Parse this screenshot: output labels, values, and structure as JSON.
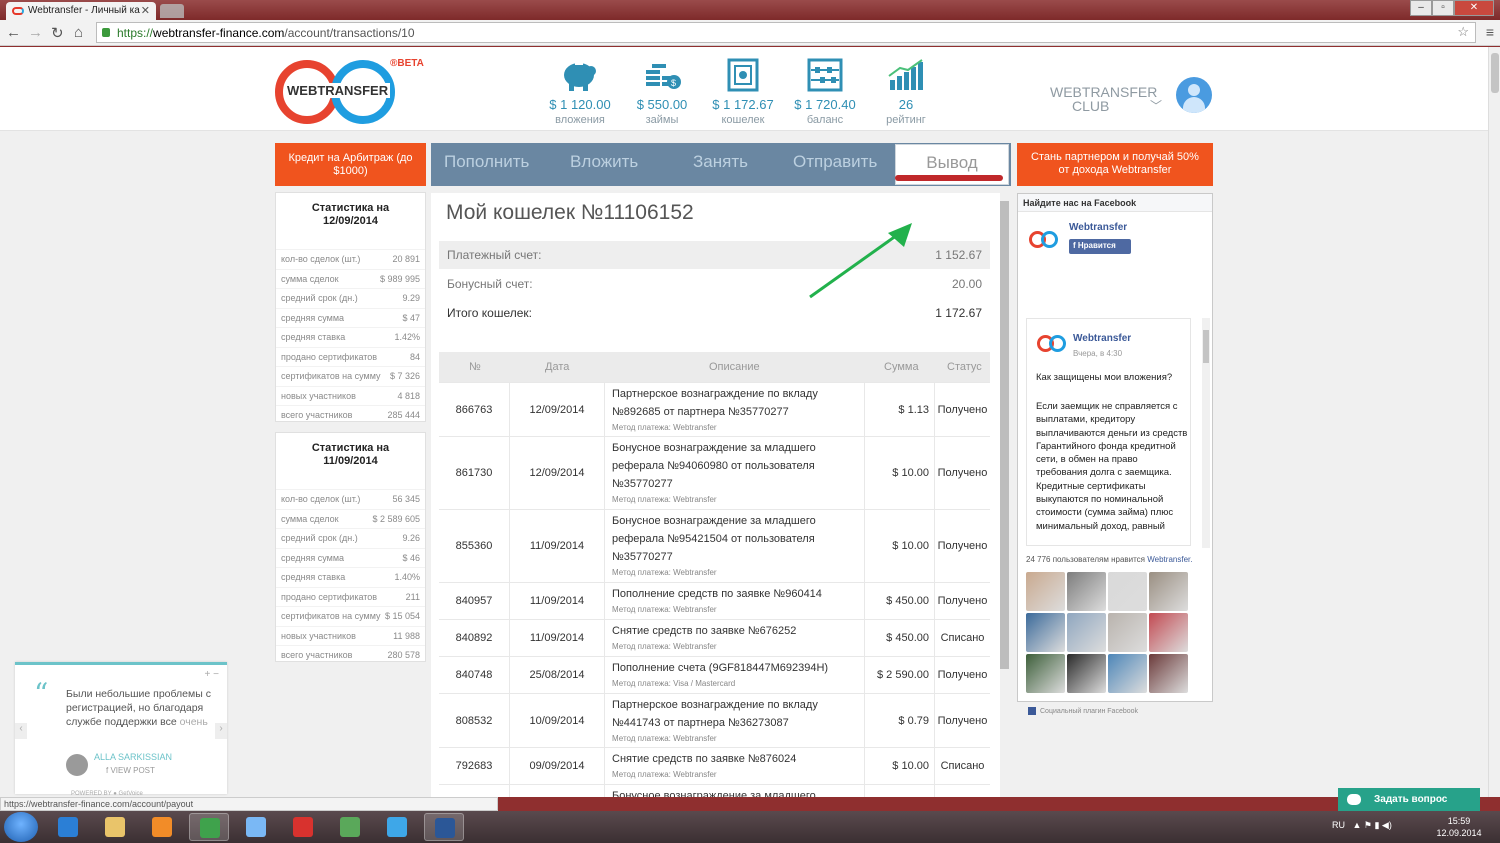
{
  "browser": {
    "tab_title": "Webtransfer - Личный ка",
    "url_scheme": "https://",
    "url_domain": "webtransfer-finance.com",
    "url_path": "/account/transactions/10",
    "status_url": "https://webtransfer-finance.com/account/payout"
  },
  "header": {
    "logo_text": "WEBTRANSFER",
    "beta": "®BETA",
    "stats": [
      {
        "icon": "piggy-bank-icon",
        "value": "$ 1 120.00",
        "label": "вложения"
      },
      {
        "icon": "coins-icon",
        "value": "$ 550.00",
        "label": "займы"
      },
      {
        "icon": "safe-icon",
        "value": "$ 1 172.67",
        "label": "кошелек"
      },
      {
        "icon": "abacus-icon",
        "value": "$ 1 720.40",
        "label": "баланс"
      },
      {
        "icon": "rating-chart-icon",
        "value": "26",
        "label": "рейтинг"
      }
    ],
    "club_line1": "WEBTRANSFER",
    "club_line2": "CLUB"
  },
  "left_promo": "Кредит на Арбитраж (до $1000)",
  "right_promo": "Стань партнером и получай 50% от дохода Webtransfer",
  "tabs": [
    "Пополнить",
    "Вложить",
    "Занять",
    "Отправить",
    "Вывод"
  ],
  "stat_boxes": [
    {
      "title_line1": "Статистика на",
      "title_line2": "12/09/2014",
      "rows": [
        {
          "label": "кол-во сделок (шт.)",
          "value": "20 891"
        },
        {
          "label": "сумма сделок",
          "value": "$ 989 995"
        },
        {
          "label": "средний срок (дн.)",
          "value": "9.29"
        },
        {
          "label": "средняя сумма",
          "value": "$ 47"
        },
        {
          "label": "средняя ставка",
          "value": "1.42%"
        },
        {
          "label": "продано сертификатов",
          "value": "84"
        },
        {
          "label": "сертификатов на сумму",
          "value": "$ 7 326"
        },
        {
          "label": "новых участников",
          "value": "4 818"
        },
        {
          "label": "всего участников",
          "value": "285 444"
        }
      ]
    },
    {
      "title_line1": "Статистика на",
      "title_line2": "11/09/2014",
      "rows": [
        {
          "label": "кол-во сделок (шт.)",
          "value": "56 345"
        },
        {
          "label": "сумма сделок",
          "value": "$ 2 589 605"
        },
        {
          "label": "средний срок (дн.)",
          "value": "9.26"
        },
        {
          "label": "средняя сумма",
          "value": "$ 46"
        },
        {
          "label": "средняя ставка",
          "value": "1.40%"
        },
        {
          "label": "продано сертификатов",
          "value": "211"
        },
        {
          "label": "сертификатов на сумму",
          "value": "$ 15 054"
        },
        {
          "label": "новых участников",
          "value": "11 988"
        },
        {
          "label": "всего участников",
          "value": "280 578"
        }
      ]
    }
  ],
  "wallet": {
    "title": "Мой кошелек №11106152",
    "summary": [
      {
        "label": "Платежный счет:",
        "value": "1 152.67"
      },
      {
        "label": "Бонусный счет:",
        "value": "20.00"
      },
      {
        "label": "Итого кошелек:",
        "value": "1 172.67"
      }
    ],
    "columns": [
      "№",
      "Дата",
      "Описание",
      "Сумма",
      "Статус"
    ],
    "rows": [
      {
        "id": "866763",
        "date": "12/09/2014",
        "desc": "Партнерское вознаграждение по вкладу №892685 от партнера №35770277",
        "method": "Метод платежа: Webtransfer",
        "amount": "$ 1.13",
        "status": "Получено"
      },
      {
        "id": "861730",
        "date": "12/09/2014",
        "desc": "Бонусное вознаграждение за младшего реферала №94060980 от пользователя №35770277",
        "method": "Метод платежа: Webtransfer",
        "amount": "$ 10.00",
        "status": "Получено"
      },
      {
        "id": "855360",
        "date": "11/09/2014",
        "desc": "Бонусное вознаграждение за младшего реферала №95421504 от пользователя №35770277",
        "method": "Метод платежа: Webtransfer",
        "amount": "$ 10.00",
        "status": "Получено"
      },
      {
        "id": "840957",
        "date": "11/09/2014",
        "desc": "Пополнение средств по заявке №960414",
        "method": "Метод платежа: Webtransfer",
        "amount": "$ 450.00",
        "status": "Получено"
      },
      {
        "id": "840892",
        "date": "11/09/2014",
        "desc": "Снятие средств по заявке №676252",
        "method": "Метод платежа: Webtransfer",
        "amount": "$ 450.00",
        "status": "Списано"
      },
      {
        "id": "840748",
        "date": "25/08/2014",
        "desc": "Пополнение счета (9GF818447M692394H)",
        "method": "Метод платежа: Visa / Mastercard",
        "amount": "$ 2 590.00",
        "status": "Получено"
      },
      {
        "id": "808532",
        "date": "10/09/2014",
        "desc": "Партнерское вознаграждение по вкладу №441743 от партнера №36273087",
        "method": "Метод платежа: Webtransfer",
        "amount": "$ 0.79",
        "status": "Получено"
      },
      {
        "id": "792683",
        "date": "09/09/2014",
        "desc": "Снятие средств по заявке №876024",
        "method": "Метод платежа: Webtransfer",
        "amount": "$ 10.00",
        "status": "Списано"
      },
      {
        "id": "",
        "date": "",
        "desc": "Бонусное вознаграждение за младшего",
        "method": "",
        "amount": "",
        "status": ""
      }
    ]
  },
  "facebook": {
    "header": "Найдите нас на Facebook",
    "page_name": "Webtransfer",
    "like_label": "Нравится",
    "post_author": "Webtransfer",
    "post_time": "Вчера, в 4:30",
    "post_question": "Как защищены мои вложения?",
    "post_body": "Если заемщик не справляется с выплатами, кредитору выплачиваются деньги из средств Гарантийного фонда кредитной сети, в обмен на право требования долга с заемщика. Кредитные сертификаты выкупаются по номинальной стоимости (сумма займа) плюс минимальный доход, равный",
    "fans_count": "24 776 пользователям нравится",
    "fans_page": "Webtransfer.",
    "plugin": "Социальный плагин Facebook",
    "photo_colors": [
      "#c9a98f",
      "#7d7d7d",
      "#d9d9d9",
      "#9a8f82",
      "#3b6a9a",
      "#8fa6bf",
      "#b9b3ad",
      "#c24a52",
      "#3d5f3a",
      "#2a2a2a",
      "#4d86b8",
      "#6b3a3a"
    ]
  },
  "testimonial": {
    "text": "Были небольшие проблемы с регистрацией, но благодаря службе поддержки все",
    "more": "очень",
    "author": "ALLA SARKISSIAN",
    "view": "VIEW POST",
    "powered": "POWERED BY ● GetVoice"
  },
  "ask_button": "Задать вопрос",
  "taskbar": {
    "lang": "RU",
    "time": "15:59",
    "date": "12.09.2014",
    "apps": [
      {
        "name": "ie-icon",
        "color": "#2b7fd6"
      },
      {
        "name": "explorer-icon",
        "color": "#e9c46a"
      },
      {
        "name": "media-player-icon",
        "color": "#f28c28"
      },
      {
        "name": "chrome-icon",
        "color": "#3fa24c"
      },
      {
        "name": "volume-app-icon",
        "color": "#7ab8f5"
      },
      {
        "name": "yandex-icon",
        "color": "#d8322e"
      },
      {
        "name": "download-icon",
        "color": "#5aa85a"
      },
      {
        "name": "skype-icon",
        "color": "#3ea7e8"
      },
      {
        "name": "word-icon",
        "color": "#2b5797"
      }
    ]
  },
  "colors": {
    "orange": "#f0541e",
    "tab_bar": "#6a87a2",
    "accent_blue": "#2f8fb4",
    "red": "#c0282a",
    "arrow": "#22b14c"
  }
}
